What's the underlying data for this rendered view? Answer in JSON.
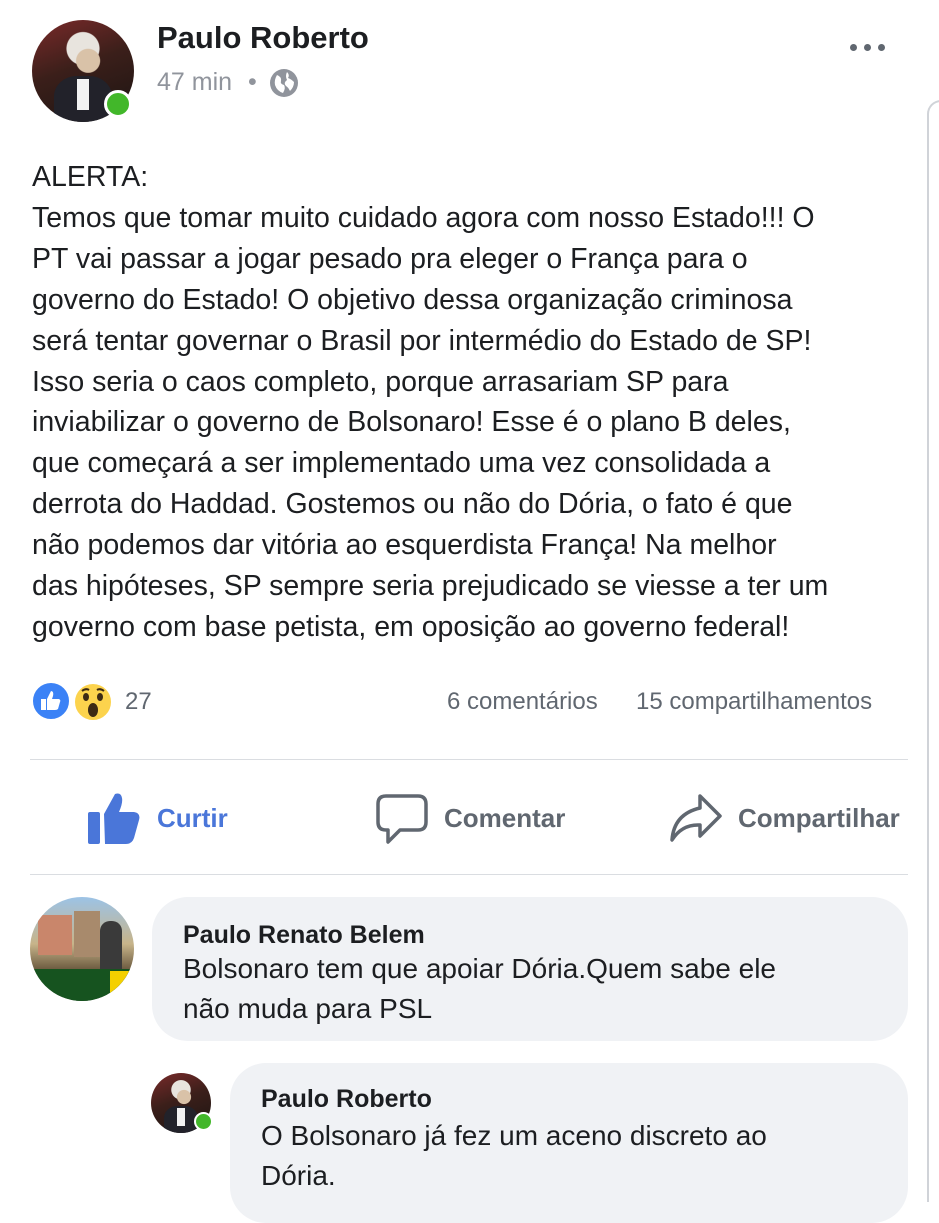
{
  "post": {
    "author": "Paulo Roberto",
    "time": "47 min",
    "separator": "•",
    "audience_icon": "globe-icon",
    "text": "ALERTA:\nTemos que tomar muito cuidado agora com nosso Estado!!! O\nPT vai passar a jogar pesado pra eleger o França para o\ngoverno do Estado! O objetivo dessa organização criminosa\nserá tentar governar o Brasil por intermédio do Estado de SP!\nIsso seria o caos completo, porque arrasariam SP para\ninviabilizar o governo de Bolsonaro! Esse é o plano B deles,\nque começará a ser implementado uma vez consolidada a\nderrota do Haddad. Gostemos ou não do Dória, o fato é que\nnão podemos dar vitória ao esquerdista França! Na melhor\ndas hipóteses, SP sempre seria prejudicado se viesse a ter um\ngoverno com base petista,  em oposição ao governo federal!"
  },
  "reactions": {
    "count": "27",
    "comments": "6 comentários",
    "shares": "15 compartilhamentos",
    "icons": [
      "like-reaction-icon",
      "wow-reaction-icon"
    ]
  },
  "actions": {
    "like": "Curtir",
    "comment": "Comentar",
    "share": "Compartilhar"
  },
  "comments": [
    {
      "author": "Paulo Renato Belem",
      "text": "Bolsonaro tem que apoiar Dória.Quem sabe ele\nnão muda para PSL"
    },
    {
      "author": "Paulo Roberto",
      "text": "O Bolsonaro já fez um aceno discreto  ao\nDória."
    }
  ],
  "colors": {
    "like_blue": "#4a76d9",
    "online_green": "#42b72a",
    "text_gray": "#606770",
    "bubble_bg": "#f0f2f5"
  }
}
